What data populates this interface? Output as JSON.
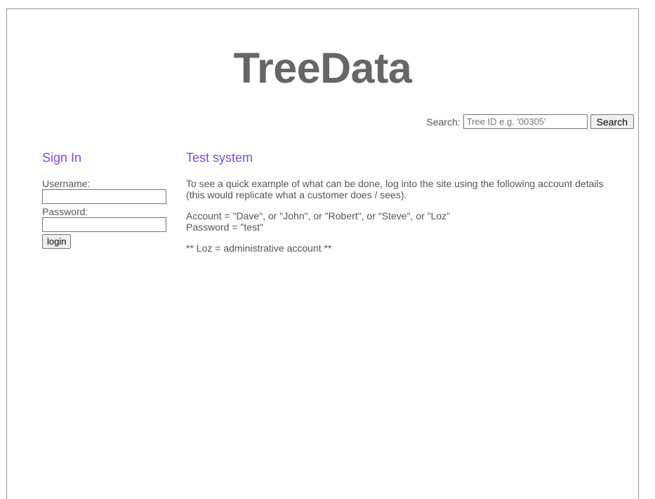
{
  "site": {
    "title": "TreeData"
  },
  "search": {
    "label": "Search:",
    "placeholder": "Tree ID e.g. '00305'",
    "button_label": "Search"
  },
  "sign_in": {
    "heading": "Sign In",
    "username_label": "Username:",
    "password_label": "Password:",
    "login_label": "login"
  },
  "main": {
    "heading": "Test system",
    "intro_line1": "To see a quick example of what can be done, log into the site using the following account details",
    "intro_line2": "(this would replicate what a customer does / sees).",
    "accounts_line": "Account = \"Dave\", or \"John\", or \"Robert\", or \"Steve\", or \"Loz\"",
    "password_line": "Password = \"test\"",
    "admin_note": "** Loz = administrative account **"
  },
  "colors": {
    "heading_accent": "#7b4be0",
    "title_gray": "#666666",
    "text_gray": "#555555"
  }
}
